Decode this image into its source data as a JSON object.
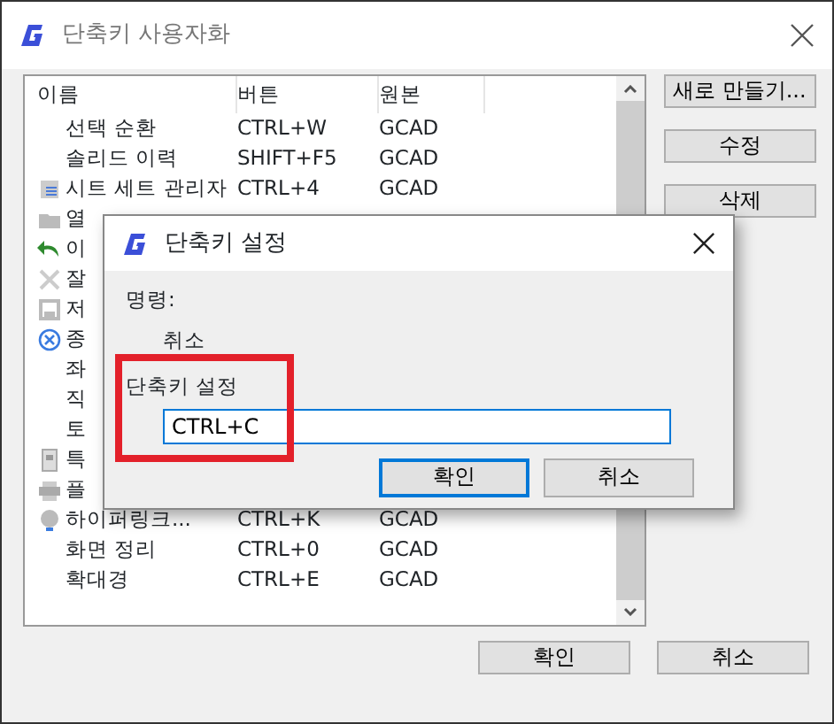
{
  "window": {
    "title": "단축키 사용자화"
  },
  "table": {
    "columns": [
      "이름",
      "버튼",
      "원본"
    ],
    "rows": [
      {
        "name": "선택 순환",
        "button": "CTRL+W",
        "source": "GCAD"
      },
      {
        "name": "솔리드 이력",
        "button": "SHIFT+F5",
        "source": "GCAD"
      },
      {
        "name": "시트 세트 관리자",
        "button": "CTRL+4",
        "source": "GCAD"
      },
      {
        "name": "열"
      },
      {
        "name": "이"
      },
      {
        "name": "잘"
      },
      {
        "name": "저"
      },
      {
        "name": "종"
      },
      {
        "name": "좌"
      },
      {
        "name": "직"
      },
      {
        "name": "토"
      },
      {
        "name": "특"
      },
      {
        "name": "플"
      },
      {
        "name": "하이퍼링크...",
        "button": "CTRL+K",
        "source": "GCAD"
      },
      {
        "name": "화면 정리",
        "button": "CTRL+0",
        "source": "GCAD"
      },
      {
        "name": "확대경",
        "button": "CTRL+E",
        "source": "GCAD"
      }
    ]
  },
  "side_buttons": [
    "새로 만들기...",
    "수정",
    "삭제"
  ],
  "footer_buttons": [
    "확인",
    "취소"
  ],
  "dialog": {
    "title": "단축키 설정",
    "command_label": "명령:",
    "command": "취소",
    "shortcut_label": "단축키 설정",
    "shortcut_value": "CTRL+C",
    "buttons": [
      {
        "label": "확인",
        "default": true
      },
      {
        "label": "취소",
        "default": false
      }
    ]
  }
}
